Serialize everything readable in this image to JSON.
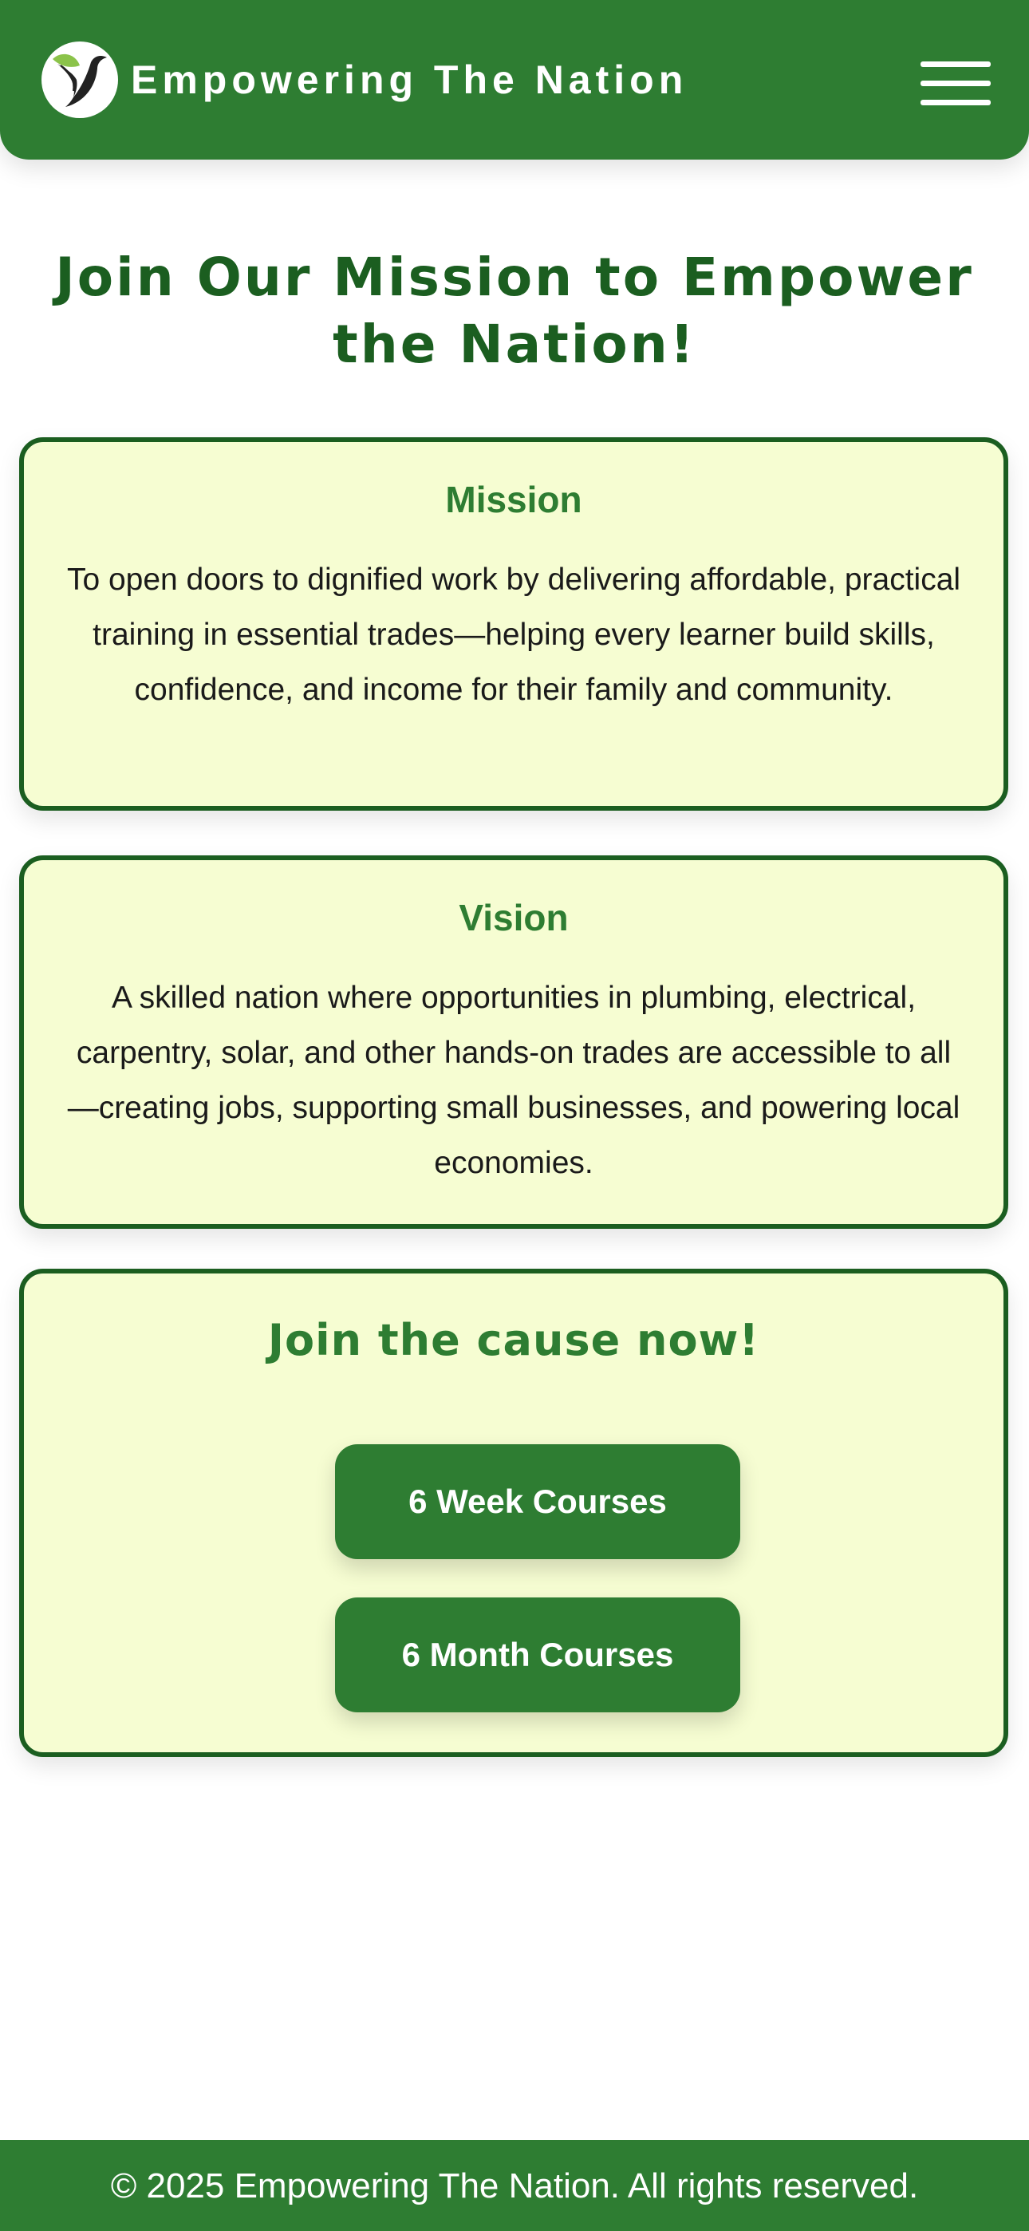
{
  "header": {
    "brand": "Empowering The Nation",
    "logo_icon": "bird-leaf-logo-icon",
    "menu_icon": "hamburger-menu-icon"
  },
  "main": {
    "title": "Join Our Mission to Empower the Nation!",
    "mission": {
      "heading": "Mission",
      "text": "To open doors to dignified work by delivering affordable, practical training in essential trades—helping every learner build skills, confidence, and income for their family and community."
    },
    "vision": {
      "heading": "Vision",
      "text": "A skilled nation where opportunities in plumbing, electrical, carpentry, solar, and other hands-on trades are accessible to all—creating jobs, supporting small businesses, and powering local economies."
    },
    "join": {
      "heading": "Join the cause now!",
      "buttons": [
        "6 Week Courses",
        "6 Month Courses"
      ]
    }
  },
  "footer": {
    "text": "© 2025 Empowering The Nation. All rights reserved."
  },
  "colors": {
    "primary": "#2e7d32",
    "dark_green": "#1b5e20",
    "card_bg": "#f6fdd2",
    "logo_leaf": "#8bc34a"
  }
}
